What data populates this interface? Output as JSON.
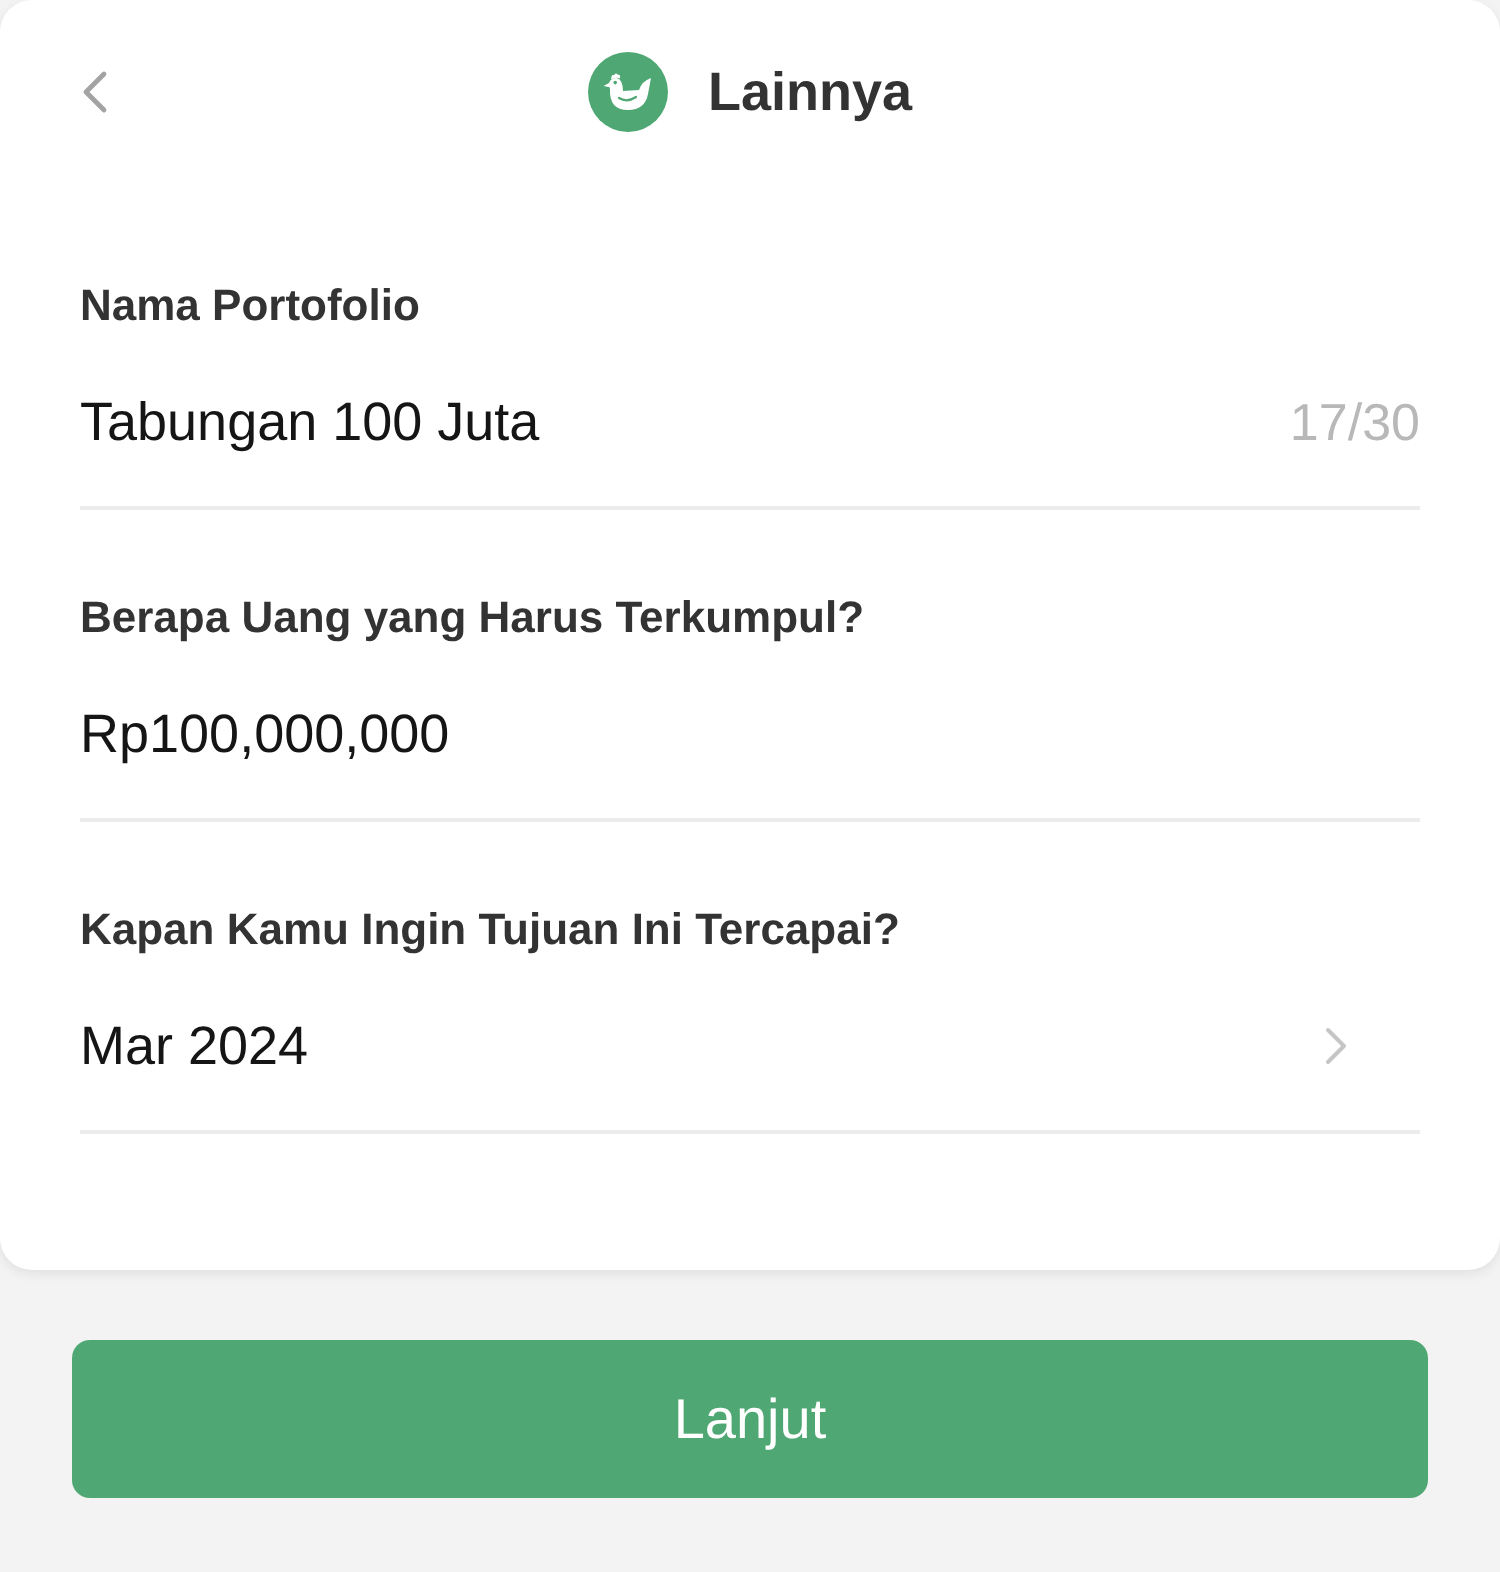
{
  "header": {
    "title": "Lainnya"
  },
  "fields": [
    {
      "kind": "text",
      "label": "Nama Portofolio",
      "value": "Tabungan 100 Juta",
      "counter": "17/30"
    },
    {
      "kind": "text",
      "label": "Berapa Uang yang Harus Terkumpul?",
      "value": "Rp100,000,000"
    },
    {
      "kind": "picker",
      "label": "Kapan Kamu Ingin Tujuan Ini Tercapai?",
      "value": "Mar 2024"
    }
  ],
  "primary_button": {
    "label": "Lanjut"
  }
}
